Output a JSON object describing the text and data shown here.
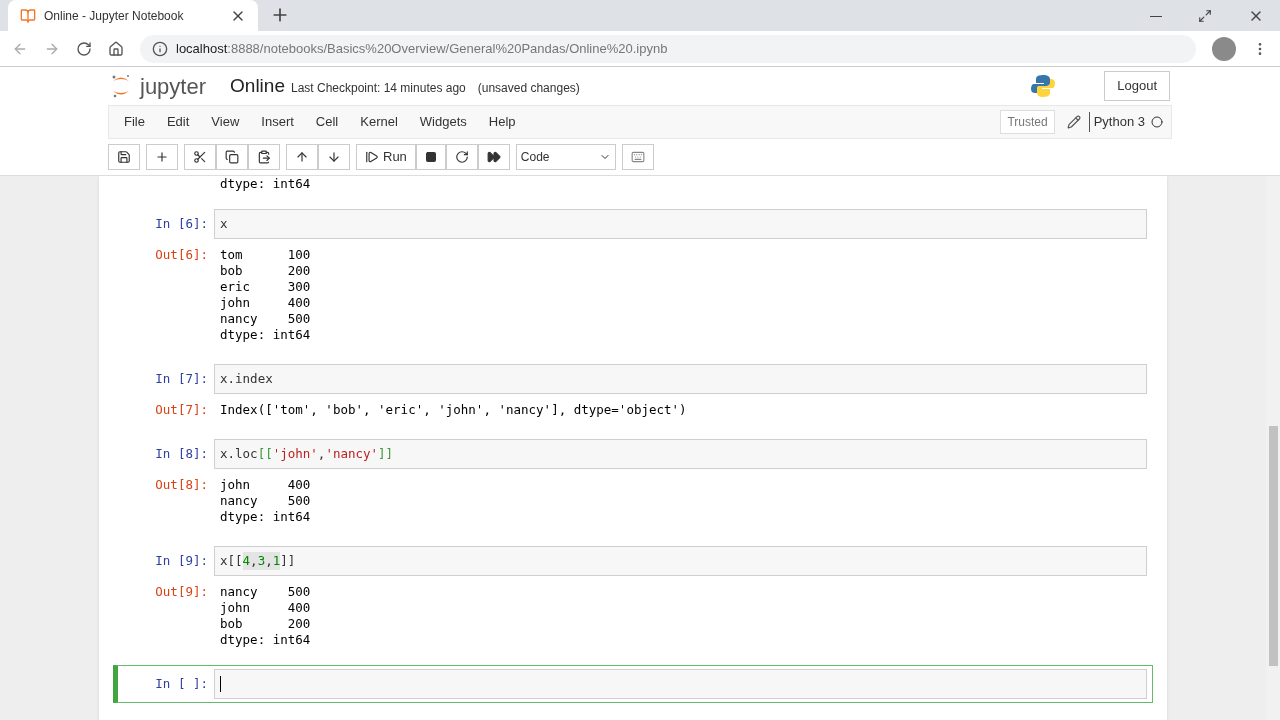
{
  "browser": {
    "tab_title": "Online - Jupyter Notebook",
    "url_host": "localhost",
    "url_rest": ":8888/notebooks/Basics%20Overview/General%20Pandas/Online%20.ipynb"
  },
  "header": {
    "logo_text": "jupyter",
    "notebook_name": "Online",
    "checkpoint": "Last Checkpoint: 14 minutes ago",
    "save_status": "(unsaved changes)",
    "logout": "Logout"
  },
  "menu": [
    "File",
    "Edit",
    "View",
    "Insert",
    "Cell",
    "Kernel",
    "Widgets",
    "Help"
  ],
  "toolbar": {
    "run": "Run",
    "cell_type": "Code",
    "trusted": "Trusted",
    "kernel": "Python 3"
  },
  "top_output": [
    "dtype: int64"
  ],
  "cells": [
    {
      "prompt": "In [6]:",
      "code": [
        {
          "kind": "plain",
          "text": "x"
        }
      ],
      "out_prompt": "Out[6]:",
      "output": [
        "tom      100",
        "bob      200",
        "eric     300",
        "john     400",
        "nancy    500",
        "dtype: int64"
      ],
      "selected": false
    },
    {
      "prompt": "In [7]:",
      "code": [
        {
          "kind": "plain",
          "text": "x.index"
        }
      ],
      "out_prompt": "Out[7]:",
      "output": [
        "Index(['tom', 'bob', 'eric', 'john', 'nancy'], dtype='object')"
      ],
      "selected": false
    },
    {
      "prompt": "In [8]:",
      "code": [
        {
          "kind": "plain",
          "text": "x.loc"
        },
        {
          "kind": "bracket",
          "text": "[["
        },
        {
          "kind": "string",
          "text": "'john'"
        },
        {
          "kind": "plain",
          "text": ","
        },
        {
          "kind": "string",
          "text": "'nancy'"
        },
        {
          "kind": "bracket",
          "text": "]]"
        }
      ],
      "out_prompt": "Out[8]:",
      "output": [
        "john     400",
        "nancy    500",
        "dtype: int64"
      ],
      "selected": false
    },
    {
      "prompt": "In [9]:",
      "code": [
        {
          "kind": "plain",
          "text": "x[["
        },
        {
          "kind": "number",
          "text": "4"
        },
        {
          "kind": "match",
          "text": ","
        },
        {
          "kind": "number",
          "text": "3"
        },
        {
          "kind": "match",
          "text": ","
        },
        {
          "kind": "number",
          "text": "1"
        },
        {
          "kind": "plain",
          "text": "]]"
        }
      ],
      "out_prompt": "Out[9]:",
      "output": [
        "nancy    500",
        "john     400",
        "bob      200",
        "dtype: int64"
      ],
      "selected": false
    },
    {
      "prompt": "In [ ]:",
      "selected": true
    }
  ]
}
